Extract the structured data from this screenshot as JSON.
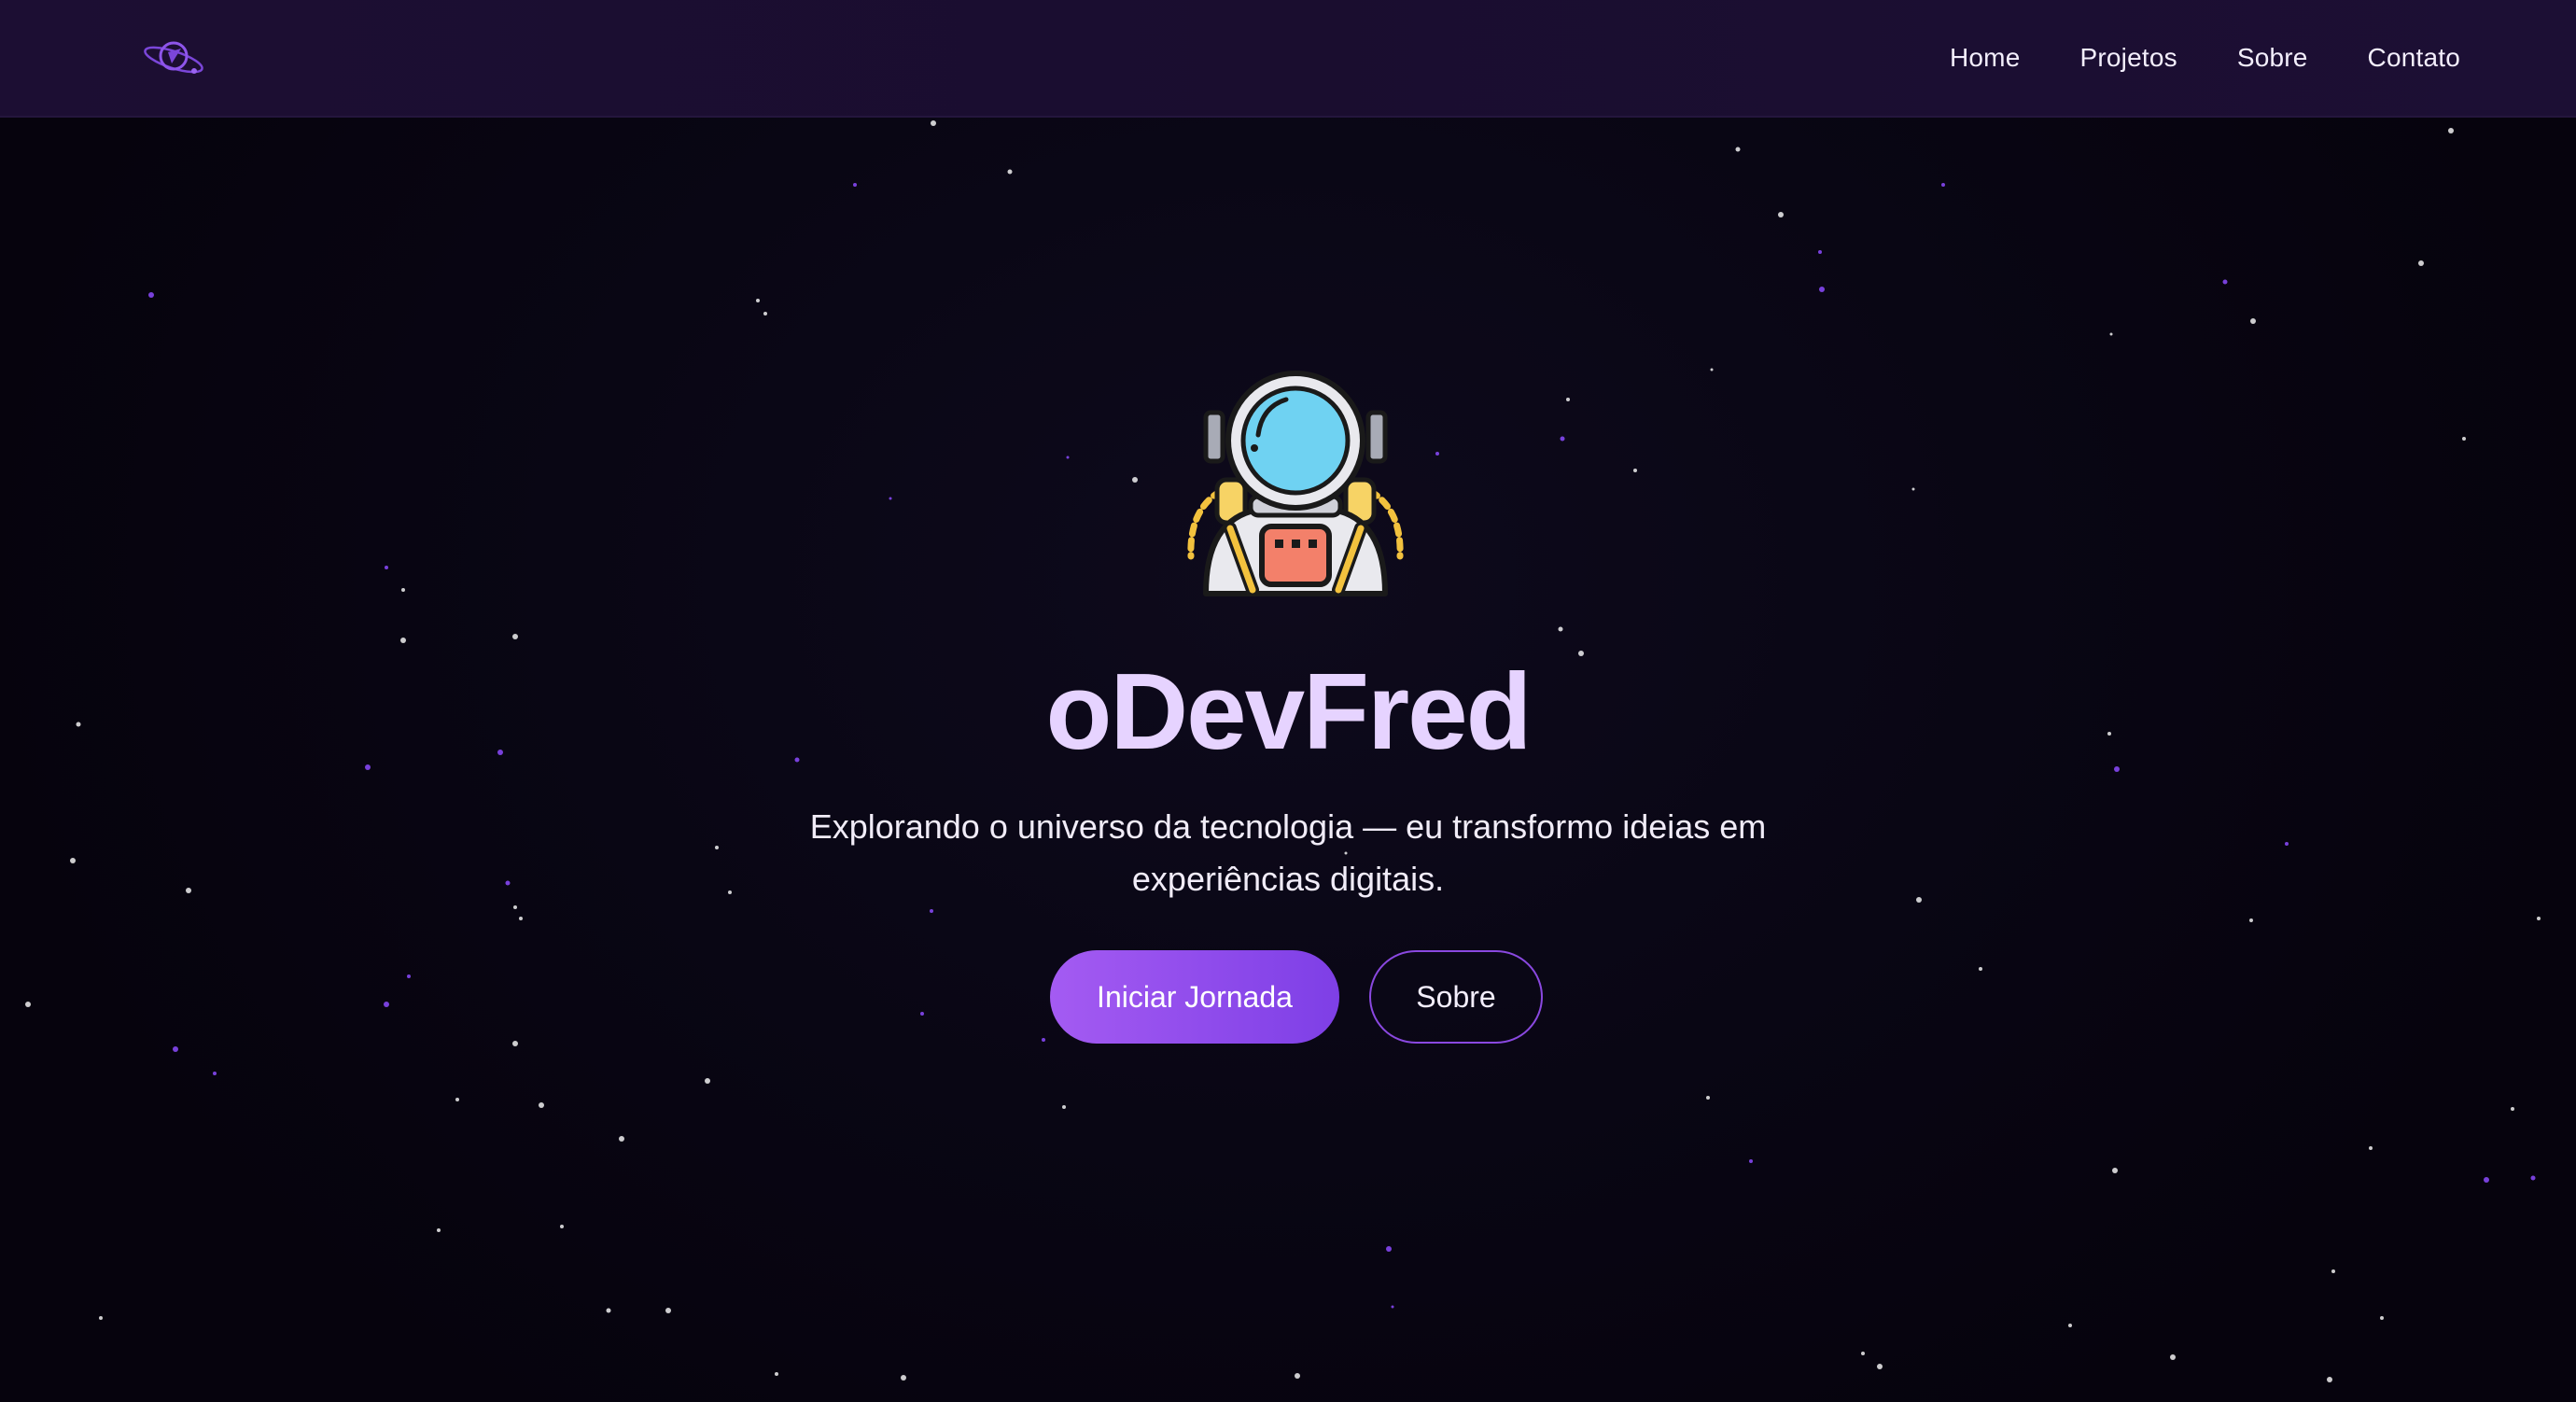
{
  "nav": {
    "logo_icon": "astronaut-orbit-logo-icon",
    "links": [
      "Home",
      "Projetos",
      "Sobre",
      "Contato"
    ]
  },
  "hero": {
    "illustration_icon": "astronaut-icon",
    "title": "oDevFred",
    "subtitle": "Explorando o universo da tecnologia — eu transformo ideias em experiências digitais.",
    "primary_button": "Iniciar Jornada",
    "secondary_button": "Sobre"
  },
  "colors": {
    "background": "#07040f",
    "navbar": "#1c0e33",
    "title": "#e6d3ff",
    "accent_start": "#a45bf2",
    "accent_end": "#7e3fe6",
    "star_white": "#ffffff",
    "star_purple": "#8c4bff"
  }
}
